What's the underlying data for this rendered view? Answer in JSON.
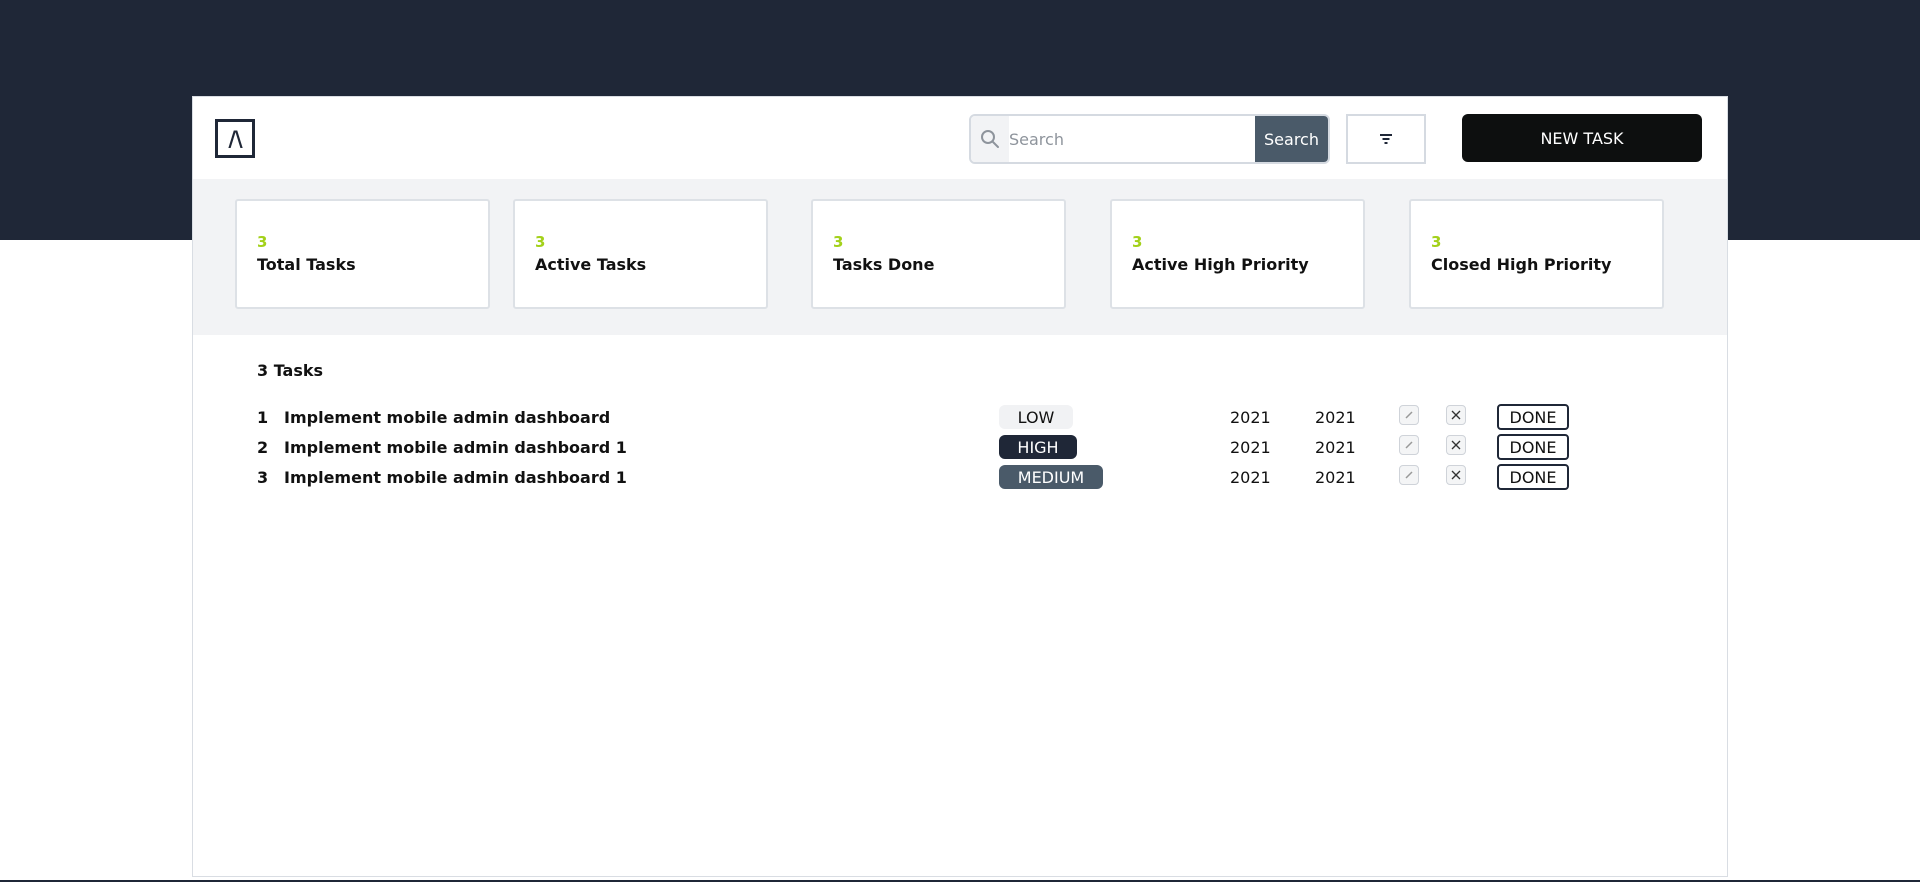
{
  "header": {
    "logo_text": "/\\",
    "search_placeholder": "Search",
    "search_button": "Search",
    "new_task_button": "NEW TASK"
  },
  "stats": [
    {
      "value": "3",
      "label": "Total Tasks"
    },
    {
      "value": "3",
      "label": "Active Tasks"
    },
    {
      "value": "3",
      "label": "Tasks Done"
    },
    {
      "value": "3",
      "label": "Active High Priority"
    },
    {
      "value": "3",
      "label": "Closed High Priority"
    }
  ],
  "tasks_count": "3 Tasks",
  "tasks": [
    {
      "num": "1",
      "title": "Implement mobile admin dashboard",
      "priority": "LOW",
      "date1": "2021",
      "date2": "2021",
      "status": "DONE"
    },
    {
      "num": "2",
      "title": "Implement mobile admin dashboard 1",
      "priority": "HIGH",
      "date1": "2021",
      "date2": "2021",
      "status": "DONE"
    },
    {
      "num": "3",
      "title": "Implement mobile admin dashboard 1",
      "priority": "MEDIUM",
      "date1": "2021",
      "date2": "2021",
      "status": "DONE"
    }
  ],
  "colors": {
    "dark_band": "#1f2737",
    "accent_green": "#a3d11a",
    "priority_high": "#1f2737",
    "priority_medium": "#4a5a69",
    "priority_low": "#f1f2f4"
  }
}
